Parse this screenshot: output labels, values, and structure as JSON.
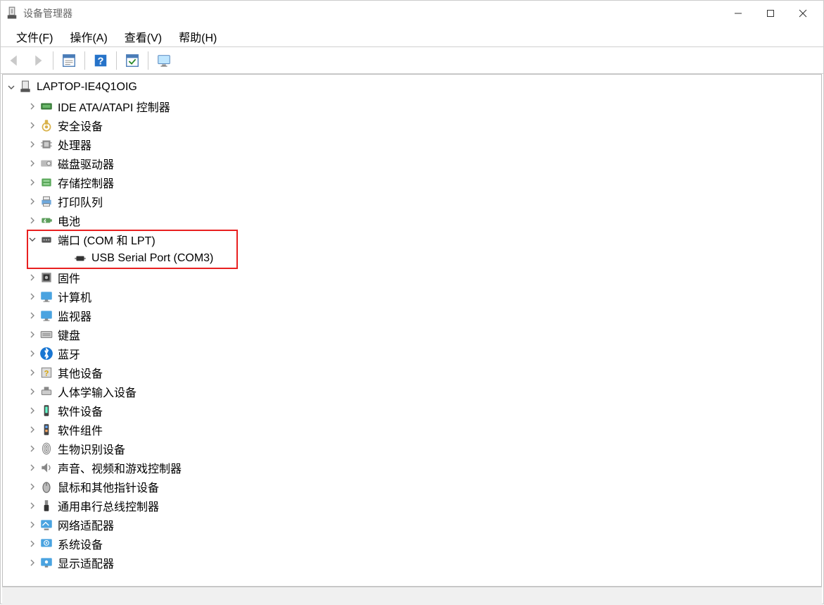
{
  "window": {
    "title": "设备管理器"
  },
  "menu": {
    "file": "文件(F)",
    "action": "操作(A)",
    "view": "查看(V)",
    "help": "帮助(H)"
  },
  "tree": {
    "root": "LAPTOP-IE4Q1OIG",
    "categories": [
      {
        "label": "IDE ATA/ATAPI 控制器",
        "icon": "ide"
      },
      {
        "label": "安全设备",
        "icon": "security"
      },
      {
        "label": "处理器",
        "icon": "cpu"
      },
      {
        "label": "磁盘驱动器",
        "icon": "disk"
      },
      {
        "label": "存储控制器",
        "icon": "storage"
      },
      {
        "label": "打印队列",
        "icon": "printer"
      },
      {
        "label": "电池",
        "icon": "battery"
      },
      {
        "label": "端口 (COM 和 LPT)",
        "icon": "port",
        "expanded": true,
        "children": [
          {
            "label": "USB Serial Port (COM3)",
            "icon": "port-device"
          }
        ]
      },
      {
        "label": "固件",
        "icon": "firmware"
      },
      {
        "label": "计算机",
        "icon": "monitor"
      },
      {
        "label": "监视器",
        "icon": "monitor"
      },
      {
        "label": "键盘",
        "icon": "keyboard"
      },
      {
        "label": "蓝牙",
        "icon": "bluetooth"
      },
      {
        "label": "其他设备",
        "icon": "other"
      },
      {
        "label": "人体学输入设备",
        "icon": "hid"
      },
      {
        "label": "软件设备",
        "icon": "software"
      },
      {
        "label": "软件组件",
        "icon": "component"
      },
      {
        "label": "生物识别设备",
        "icon": "biometric"
      },
      {
        "label": "声音、视频和游戏控制器",
        "icon": "sound"
      },
      {
        "label": "鼠标和其他指针设备",
        "icon": "mouse"
      },
      {
        "label": "通用串行总线控制器",
        "icon": "usb"
      },
      {
        "label": "网络适配器",
        "icon": "network"
      },
      {
        "label": "系统设备",
        "icon": "system"
      },
      {
        "label": "显示适配器",
        "icon": "display"
      }
    ]
  }
}
